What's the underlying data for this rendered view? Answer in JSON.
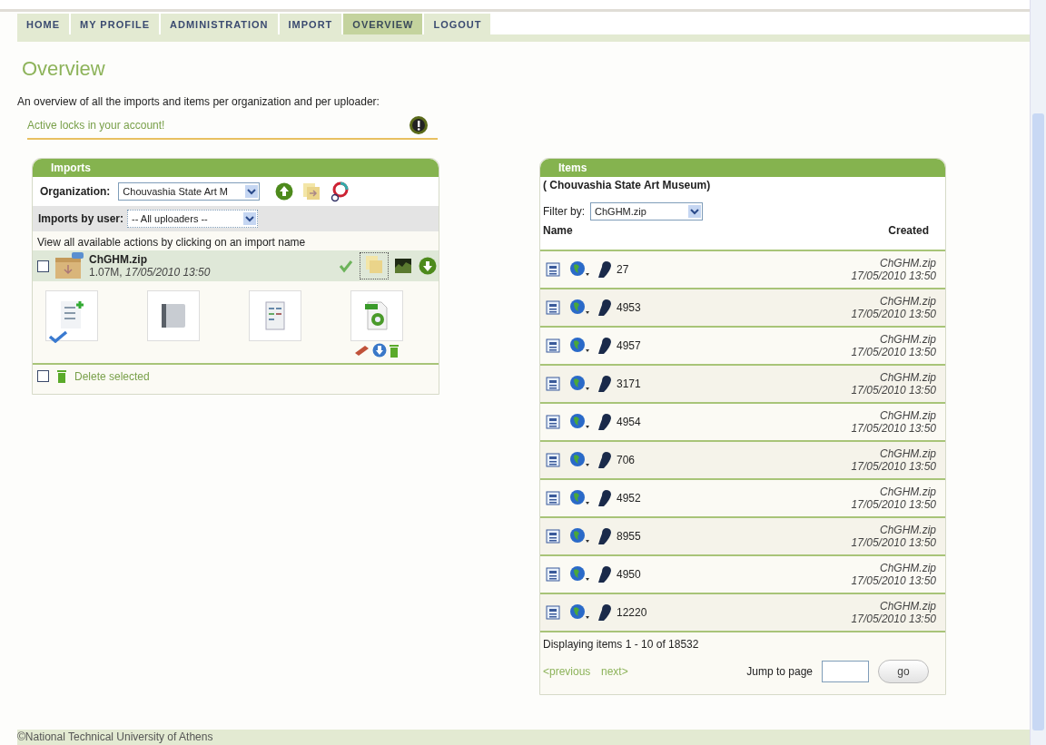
{
  "nav": [
    {
      "label": "HOME",
      "selected": false
    },
    {
      "label": "MY PROFILE",
      "selected": false
    },
    {
      "label": "ADMINISTRATION",
      "selected": false
    },
    {
      "label": "IMPORT",
      "selected": false
    },
    {
      "label": "OVERVIEW",
      "selected": true
    },
    {
      "label": "LOGOUT",
      "selected": false
    }
  ],
  "title": "Overview",
  "intro": "An overview of all the imports and items per organization and per uploader:",
  "locks": "Active locks in your account!",
  "imports": {
    "title": "Imports",
    "organization_label": "Organization:",
    "organization": "Chouvashia State Art M",
    "user_label": "Imports by user:",
    "user": "-- All uploaders --",
    "hint": "View all available actions by clicking on an import name",
    "import": {
      "name": "ChGHM.zip",
      "size": "1.07M,",
      "date": "17/05/2010 13:50",
      "checked": false
    },
    "delete_label": "Delete selected",
    "delete_checked": false
  },
  "items": {
    "title": "Items",
    "organization": "( Chouvashia State Art Museum)",
    "filter_label": "Filter by:",
    "filter": "ChGHM.zip",
    "col_name": "Name",
    "col_created": "Created",
    "rows": [
      {
        "name": "27",
        "source": "ChGHM.zip",
        "date": "17/05/2010 13:50"
      },
      {
        "name": "4953",
        "source": "ChGHM.zip",
        "date": "17/05/2010 13:50"
      },
      {
        "name": "4957",
        "source": "ChGHM.zip",
        "date": "17/05/2010 13:50"
      },
      {
        "name": "3171",
        "source": "ChGHM.zip",
        "date": "17/05/2010 13:50"
      },
      {
        "name": "4954",
        "source": "ChGHM.zip",
        "date": "17/05/2010 13:50"
      },
      {
        "name": "706",
        "source": "ChGHM.zip",
        "date": "17/05/2010 13:50"
      },
      {
        "name": "4952",
        "source": "ChGHM.zip",
        "date": "17/05/2010 13:50"
      },
      {
        "name": "8955",
        "source": "ChGHM.zip",
        "date": "17/05/2010 13:50"
      },
      {
        "name": "4950",
        "source": "ChGHM.zip",
        "date": "17/05/2010 13:50"
      },
      {
        "name": "12220",
        "source": "ChGHM.zip",
        "date": "17/05/2010 13:50"
      }
    ],
    "summary": "Displaying items 1 - 10 of 18532",
    "previous": "<previous",
    "next": "next>",
    "jump_label": "Jump to page",
    "go": "go"
  },
  "footer": "©National Technical University of Athens"
}
